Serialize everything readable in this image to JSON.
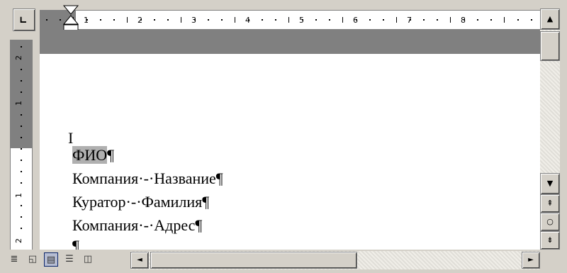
{
  "tab_selector": {
    "glyph": "∟"
  },
  "ruler": {
    "numbers": [
      "1",
      "2",
      "3",
      "4",
      "5",
      "6",
      "7",
      "8"
    ]
  },
  "vertical_ruler": {
    "numbers": [
      "2",
      "1",
      "1",
      "2"
    ]
  },
  "document": {
    "lines": [
      {
        "text": "ФИО¶",
        "selected": true
      },
      {
        "text": "Компания·-·Название¶"
      },
      {
        "text": "Куратор·-·Фамилия¶"
      },
      {
        "text": "Компания·-·Адрес¶"
      },
      {
        "text": "¶"
      }
    ]
  },
  "view_buttons": [
    {
      "icon": "normal-view-icon",
      "glyph": "≣"
    },
    {
      "icon": "web-layout-view-icon",
      "glyph": "◱"
    },
    {
      "icon": "print-layout-view-icon",
      "glyph": "▤",
      "active": true
    },
    {
      "icon": "outline-view-icon",
      "glyph": "☰"
    },
    {
      "icon": "reading-view-icon",
      "glyph": "◫"
    }
  ],
  "scroll": {
    "up": "▲",
    "down": "▼",
    "left": "◄",
    "right": "►",
    "prev_page": "⇞",
    "select_browse": "○",
    "next_page": "⇟"
  }
}
